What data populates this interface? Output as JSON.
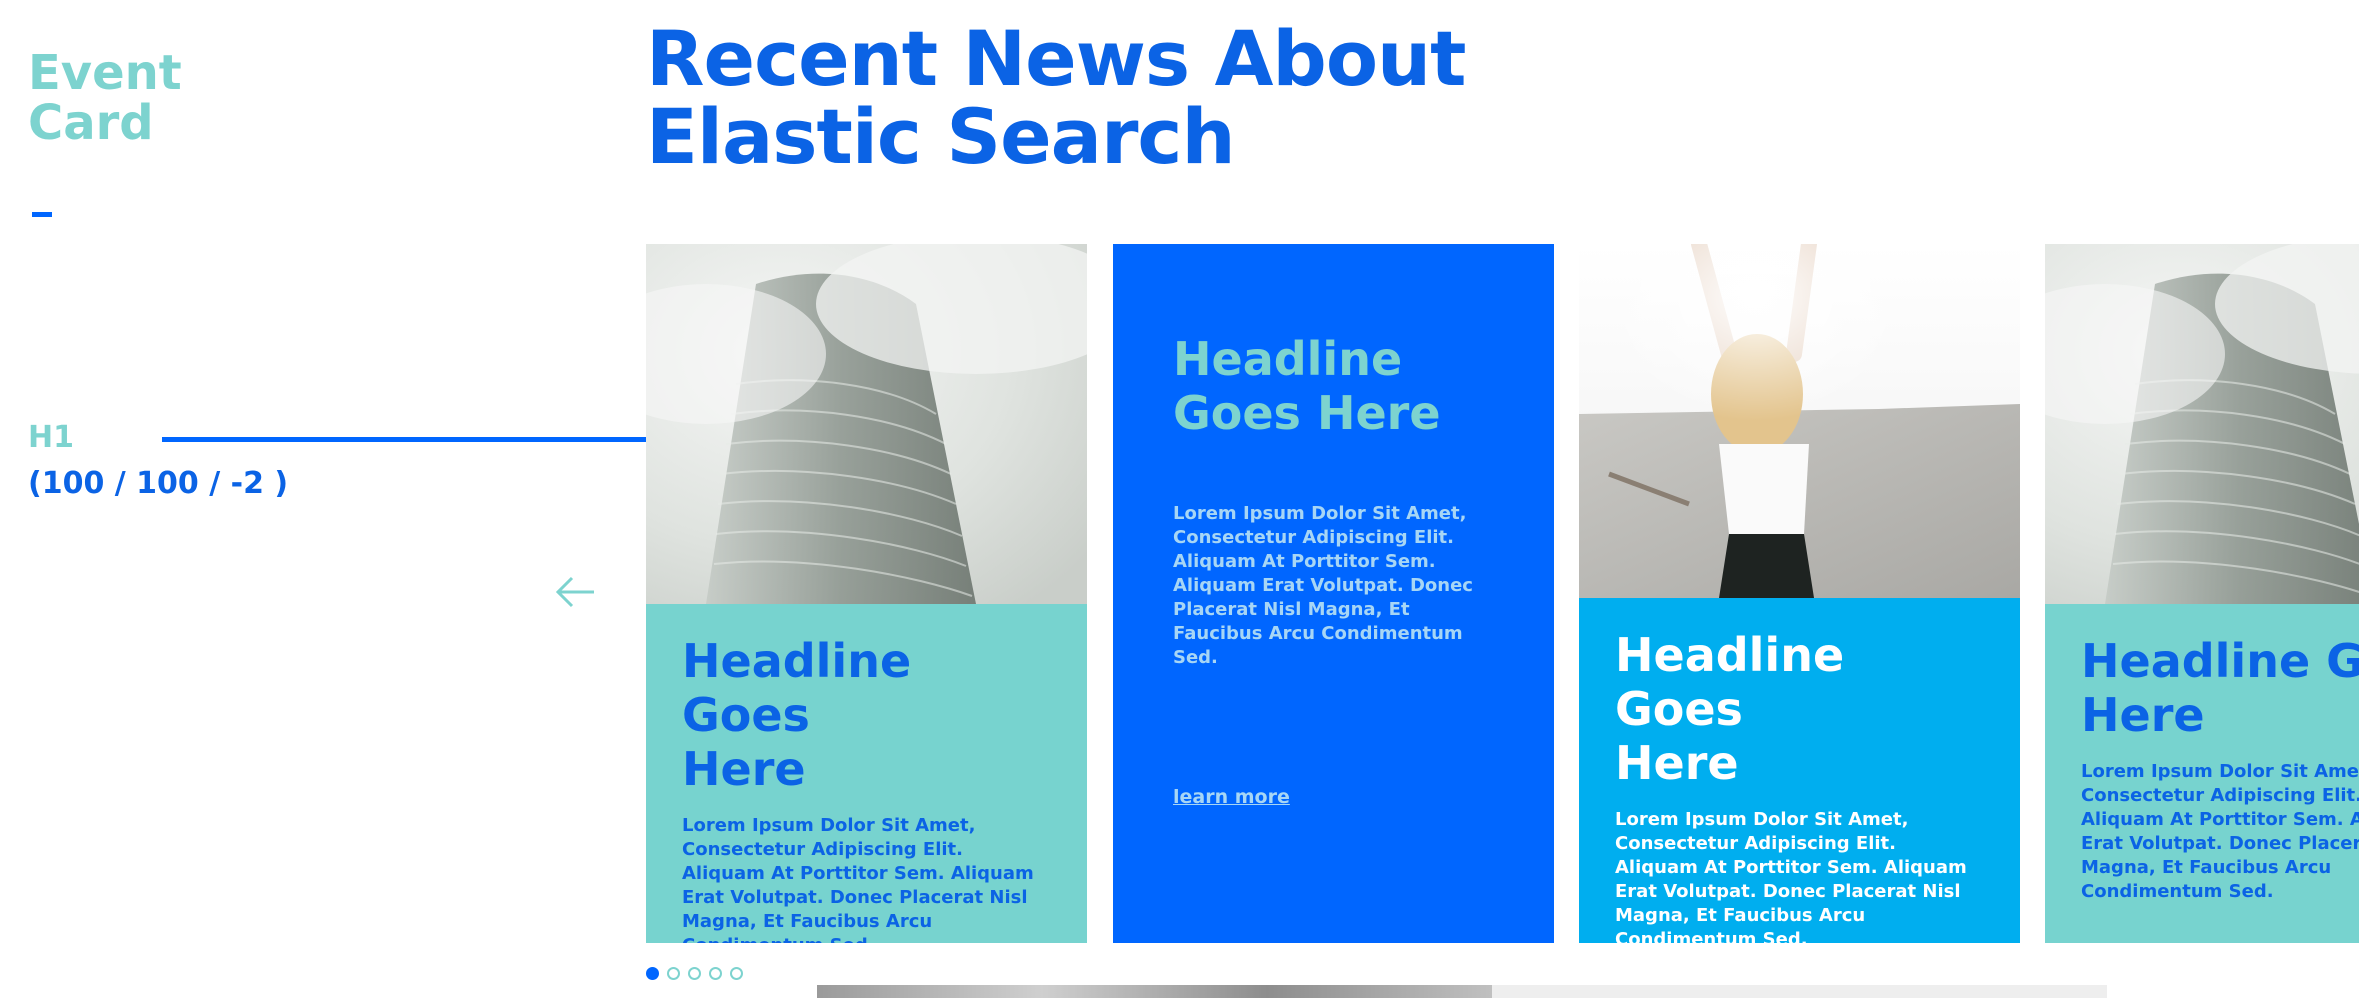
{
  "annotation": {
    "event_card_line1": "Event",
    "event_card_line2": "Card",
    "h1_label": "H1",
    "h1_spec": "(100 / 100 / -2 )"
  },
  "main": {
    "title_line1": "Recent News About",
    "title_line2": "Elastic Search"
  },
  "cards": [
    {
      "headline_line1": "Headline Goes",
      "headline_line2": "Here",
      "body": "Lorem Ipsum Dolor Sit Amet, Consectetur Adipiscing Elit. Aliquam At Porttitor Sem.  Aliquam Erat Volutpat. Donec Placerat Nisl Magna, Et Faucibus Arcu Condimentum Sed."
    },
    {
      "headline_line1": "Headline",
      "headline_line2": "Goes Here",
      "body": "Lorem Ipsum Dolor Sit Amet, Consectetur Adipiscing Elit. Aliquam At Porttitor Sem. Aliquam Erat Volutpat. Donec Placerat Nisl Magna, Et Faucibus Arcu Condimentum Sed.",
      "link": "learn more"
    },
    {
      "headline_line1": "Headline Goes",
      "headline_line2": "Here",
      "body": "Lorem Ipsum Dolor Sit Amet, Consectetur Adipiscing Elit. Aliquam At Porttitor Sem. Aliquam Erat Volutpat. Donec Placerat Nisl Magna, Et Faucibus Arcu Condimentum Sed."
    },
    {
      "headline_line1": "Headline Goes",
      "headline_line2": "Here",
      "body": "Lorem Ipsum Dolor Sit Amet, Consectetur Adipiscing Elit. Aliquam At Porttitor Sem.  Aliquam Erat Volutpat. Donec Placerat Nisl Magna, Et Faucibus Arcu Condimentum Sed."
    }
  ],
  "pagination": {
    "count": 5,
    "active_index": 0
  },
  "icons": {
    "prev": "arrow-left-icon",
    "card1_image": "building-photo",
    "card3_image": "woman-photo",
    "card4_image": "building-photo"
  },
  "colors": {
    "brand_blue": "#0066ff",
    "heading_blue": "#0b63e5",
    "teal": "#77d3cf",
    "sky": "#00aeef",
    "light_teal_text": "#7dd3cf"
  }
}
